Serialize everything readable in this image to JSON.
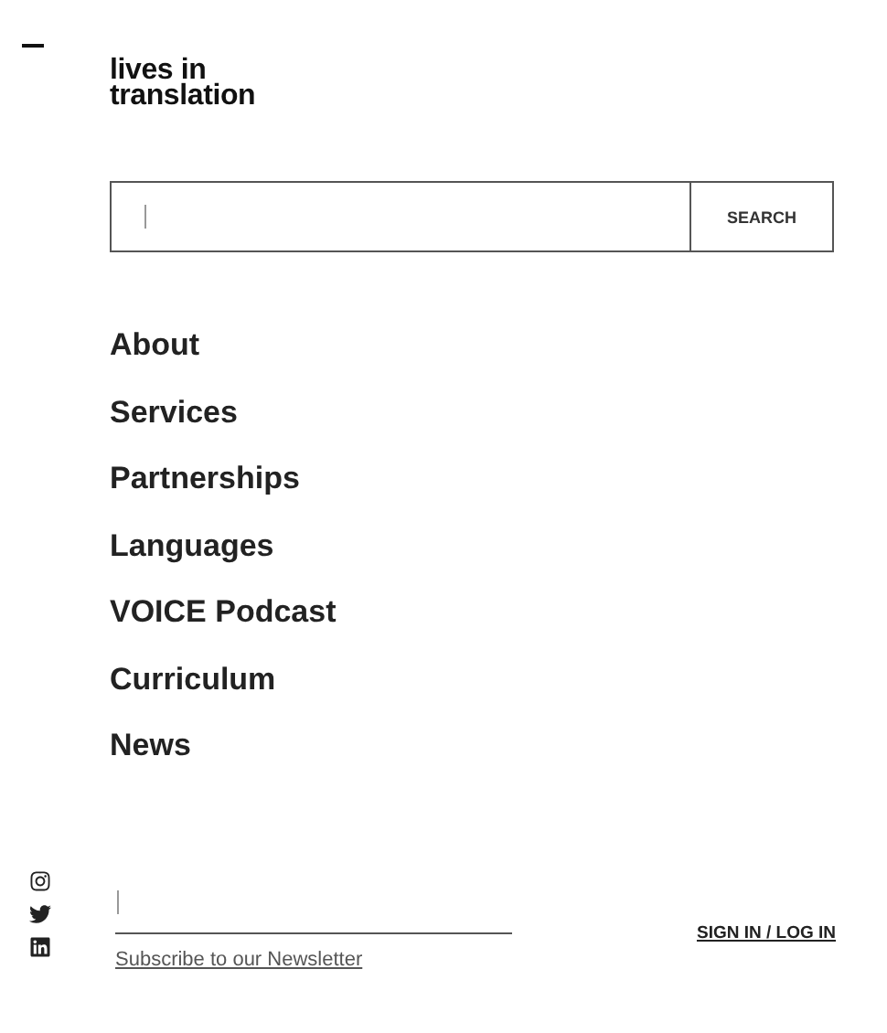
{
  "logo": "lives in\ntranslation",
  "search": {
    "button": "SEARCH"
  },
  "nav": [
    {
      "label": "About"
    },
    {
      "label": "Services"
    },
    {
      "label": "Partnerships"
    },
    {
      "label": "Languages"
    },
    {
      "label": "VOICE Podcast"
    },
    {
      "label": "Curriculum"
    },
    {
      "label": "News"
    }
  ],
  "social": [
    {
      "kind": "instagram"
    },
    {
      "kind": "twitter"
    },
    {
      "kind": "linkedin"
    }
  ],
  "newsletter": {
    "link": "Subscribe to our Newsletter"
  },
  "sign_in": "SIGN IN / LOG IN"
}
